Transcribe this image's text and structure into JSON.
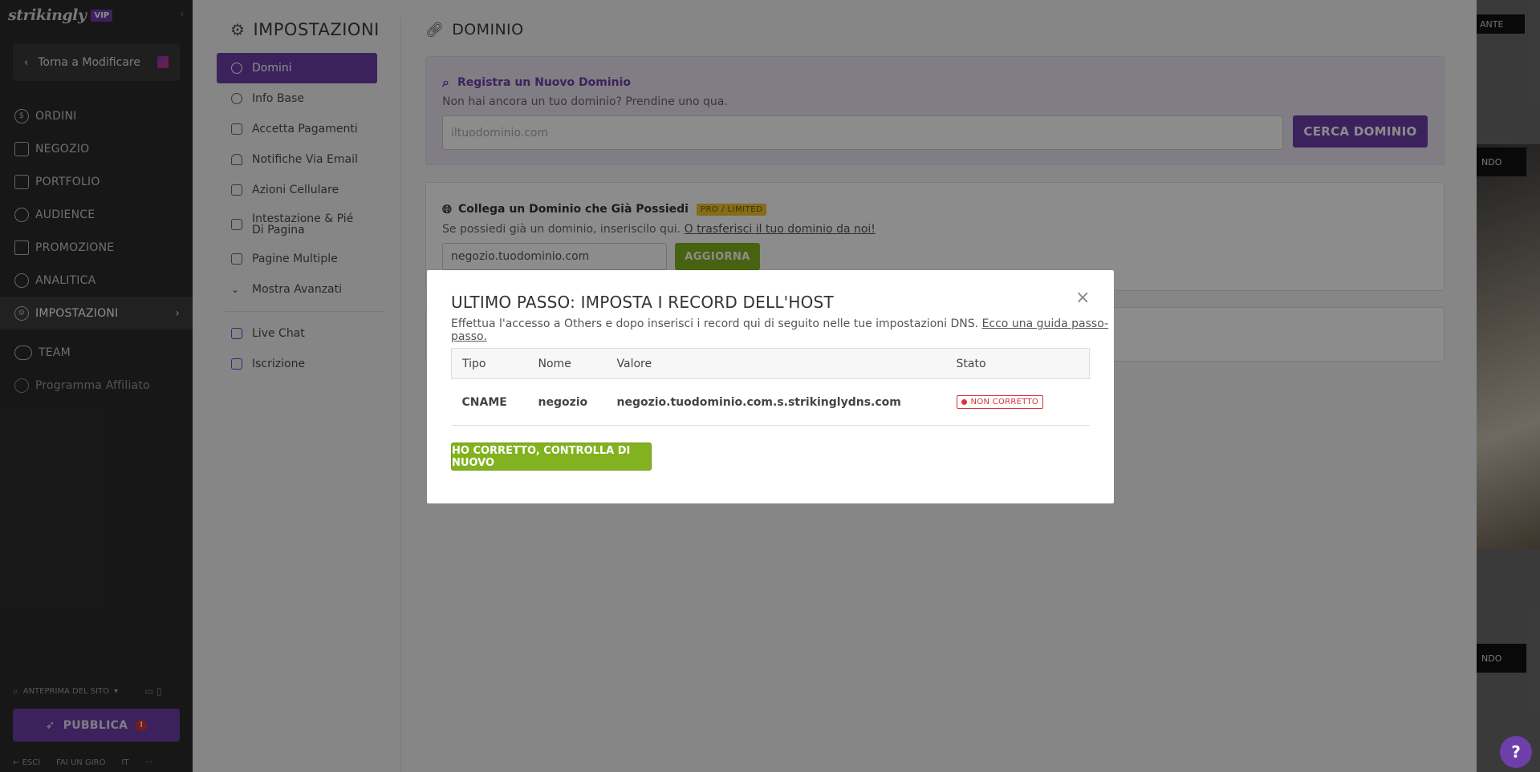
{
  "sidebar": {
    "logo": "strikingly",
    "vip": "VIP",
    "back_label": "Torna a Modificare",
    "items": [
      {
        "label": "ORDINI",
        "icon": "dollar-icon"
      },
      {
        "label": "NEGOZIO",
        "icon": "store-icon"
      },
      {
        "label": "PORTFOLIO",
        "icon": "briefcase-icon"
      },
      {
        "label": "AUDIENCE",
        "icon": "audience-icon"
      },
      {
        "label": "PROMOZIONE",
        "icon": "megaphone-icon"
      },
      {
        "label": "ANALITICA",
        "icon": "chart-icon"
      },
      {
        "label": "IMPOSTAZIONI",
        "icon": "gear-icon"
      },
      {
        "label": "TEAM",
        "icon": "team-icon"
      },
      {
        "label": "Programma Affiliato",
        "icon": "trophy-icon"
      }
    ],
    "preview_label": "ANTEPRIMA DEL SITO",
    "publish_label": "PUBBLICA",
    "publish_badge": "!",
    "bottom": {
      "exit": "ESCI",
      "tour": "FAI UN GIRO",
      "lang": "IT",
      "more": "···"
    }
  },
  "settings": {
    "title": "IMPOSTAZIONI",
    "nav": [
      {
        "label": "Domini"
      },
      {
        "label": "Info Base"
      },
      {
        "label": "Accetta Pagamenti"
      },
      {
        "label": "Notifiche Via Email"
      },
      {
        "label": "Azioni Cellulare"
      },
      {
        "label": "Intestazione & Pié Di Pagina"
      },
      {
        "label": "Pagine Multiple"
      },
      {
        "label": "Mostra Avanzati"
      },
      {
        "label": "Live Chat"
      },
      {
        "label": "Iscrizione"
      }
    ]
  },
  "domain": {
    "title": "DOMINIO",
    "register": {
      "title": "Registra un Nuovo Dominio",
      "subtitle": "Non hai ancora un tuo dominio? Prendine uno qua.",
      "placeholder": "iltuodominio.com",
      "button": "CERCA DOMINIO"
    },
    "connect": {
      "title": "Collega un Dominio che Già Possiedi",
      "badge": "PRO / LIMITED",
      "subtitle": "Se possiedi già un dominio, inseriscilo qui.",
      "transfer_link": "O trasferisci il tuo dominio da noi!",
      "value": "negozio.tuodominio.com",
      "button": "AGGIORNA"
    }
  },
  "preview": {
    "tag": "ANTE",
    "btn1": "NDO",
    "btn2": "NDO"
  },
  "modal": {
    "title": "ULTIMO PASSO: IMPOSTA I RECORD DELL'HOST",
    "description": "Effettua l'accesso a Others e dopo inserisci i record qui di seguito nelle tue impostazioni DNS.",
    "guide_link": "Ecco una guida passo-passo.",
    "columns": [
      "Tipo",
      "Nome",
      "Valore",
      "Stato"
    ],
    "row": {
      "tipo": "CNAME",
      "nome": "negozio",
      "valore": "negozio.tuodominio.com.s.strikinglydns.com",
      "stato": "NON CORRETTO"
    },
    "recheck_button": "HO CORRETTO, CONTROLLA DI NUOVO"
  },
  "help": "?",
  "colors": {
    "accent": "#6d3fa8",
    "green": "#82b21f",
    "error": "#d6343b"
  }
}
